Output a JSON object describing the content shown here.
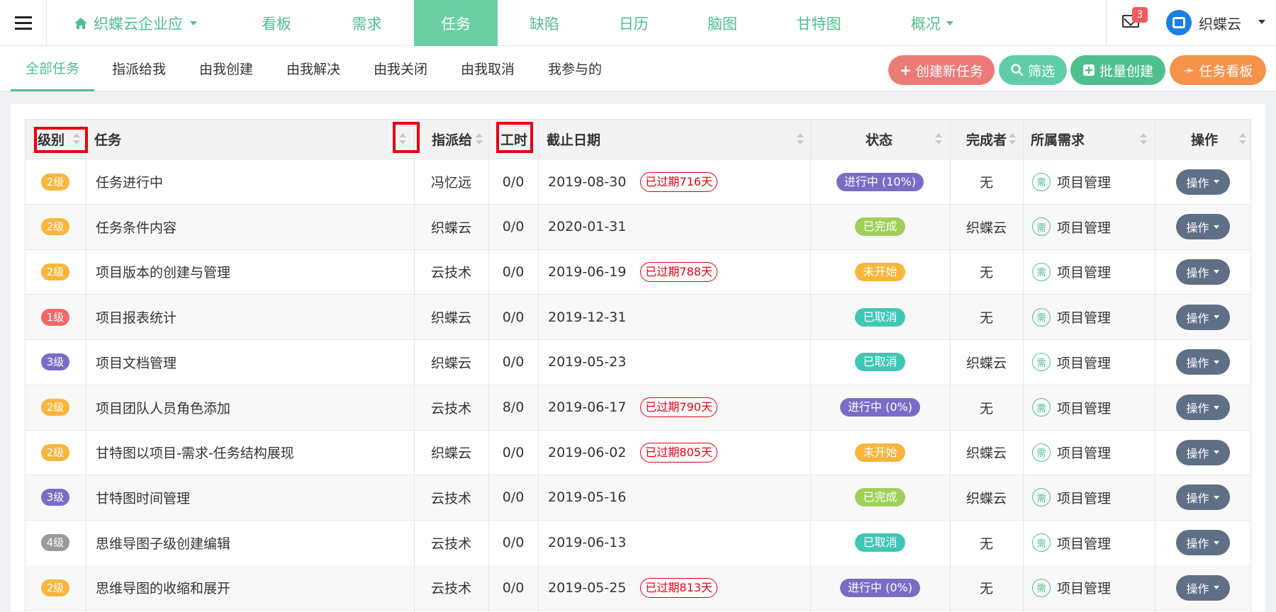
{
  "nav": {
    "project": "织蝶云企业应",
    "tabs": [
      "看板",
      "需求",
      "任务",
      "缺陷",
      "日历",
      "脑图",
      "甘特图",
      "概况"
    ],
    "active_tab": "任务",
    "mail_count": "3",
    "username": "织蝶云"
  },
  "subtabs": [
    "全部任务",
    "指派给我",
    "由我创建",
    "由我解决",
    "由我关闭",
    "由我取消",
    "我参与的"
  ],
  "actions": {
    "create": "创建新任务",
    "filter": "筛选",
    "batch": "批量创建",
    "board": "任务看板"
  },
  "table": {
    "headers": {
      "level": "级别",
      "task": "任务",
      "assignee": "指派给",
      "hours": "工时",
      "deadline": "截止日期",
      "status": "状态",
      "finisher": "完成者",
      "requirement": "所属需求",
      "operation": "操作"
    },
    "op_label": "操作",
    "req_icon_char": "需",
    "rows": [
      {
        "level": "2级",
        "task": "任务进行中",
        "assignee": "冯忆远",
        "hours": "0/0",
        "deadline": "2019-08-30",
        "overdue": "已过期716天",
        "status": "进行中 (10%)",
        "finisher": "无",
        "requirement": "项目管理"
      },
      {
        "level": "2级",
        "task": "任务条件内容",
        "assignee": "织蝶云",
        "hours": "0/0",
        "deadline": "2020-01-31",
        "overdue": "",
        "status": "已完成",
        "finisher": "织蝶云",
        "requirement": "项目管理"
      },
      {
        "level": "2级",
        "task": "项目版本的创建与管理",
        "assignee": "云技术",
        "hours": "0/0",
        "deadline": "2019-06-19",
        "overdue": "已过期788天",
        "status": "未开始",
        "finisher": "无",
        "requirement": "项目管理"
      },
      {
        "level": "1级",
        "task": "项目报表统计",
        "assignee": "织蝶云",
        "hours": "0/0",
        "deadline": "2019-12-31",
        "overdue": "",
        "status": "已取消",
        "finisher": "无",
        "requirement": "项目管理"
      },
      {
        "level": "3级",
        "task": "项目文档管理",
        "assignee": "织蝶云",
        "hours": "0/0",
        "deadline": "2019-05-23",
        "overdue": "",
        "status": "已取消",
        "finisher": "织蝶云",
        "requirement": "项目管理"
      },
      {
        "level": "2级",
        "task": "项目团队人员角色添加",
        "assignee": "云技术",
        "hours": "8/0",
        "deadline": "2019-06-17",
        "overdue": "已过期790天",
        "status": "进行中 (0%)",
        "finisher": "无",
        "requirement": "项目管理"
      },
      {
        "level": "2级",
        "task": "甘特图以项目-需求-任务结构展现",
        "assignee": "织蝶云",
        "hours": "0/0",
        "deadline": "2019-06-02",
        "overdue": "已过期805天",
        "status": "未开始",
        "finisher": "织蝶云",
        "requirement": "项目管理"
      },
      {
        "level": "3级",
        "task": "甘特图时间管理",
        "assignee": "云技术",
        "hours": "0/0",
        "deadline": "2019-05-16",
        "overdue": "",
        "status": "已完成",
        "finisher": "织蝶云",
        "requirement": "项目管理"
      },
      {
        "level": "4级",
        "task": "思维导图子级创建编辑",
        "assignee": "云技术",
        "hours": "0/0",
        "deadline": "2019-06-13",
        "overdue": "",
        "status": "已取消",
        "finisher": "无",
        "requirement": "项目管理"
      },
      {
        "level": "2级",
        "task": "思维导图的收缩和展开",
        "assignee": "云技术",
        "hours": "0/0",
        "deadline": "2019-05-25",
        "overdue": "已过期813天",
        "status": "进行中 (0%)",
        "finisher": "无",
        "requirement": "项目管理"
      }
    ]
  },
  "colors": {
    "accent": "#4fc08d",
    "active_tab_bg": "#6ccfa4",
    "create_btn": "#ec7b78",
    "filter_btn": "#5fcea8",
    "batch_btn": "#4fc08d",
    "board_btn": "#f6924a",
    "level_1": "#f06868",
    "level_2": "#f8b63c",
    "level_3": "#7a6cc6",
    "level_4": "#9a9a9a",
    "status_in_progress": "#7a6cc6",
    "status_done": "#9ed05a",
    "status_not_started": "#f8b63c",
    "status_cancelled": "#3fc7b6",
    "overdue": "#e60012",
    "op_button": "#5f6f86"
  }
}
